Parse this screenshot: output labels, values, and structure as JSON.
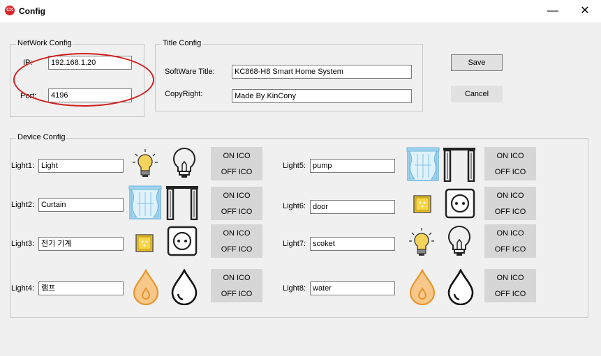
{
  "window": {
    "title": "Config",
    "app_icon_text": "CX",
    "minimize": "—",
    "maximize": "☐",
    "close": "✕"
  },
  "network": {
    "legend": "NetWork Config",
    "ip_label": "IP:",
    "ip_value": "192.168.1.20",
    "port_label": "Port:",
    "port_value": "4196"
  },
  "title_config": {
    "legend": "Title Config",
    "software_label": "SoftWare Title:",
    "software_value": "KC868-H8 Smart Home System",
    "copyright_label": "CopyRight:",
    "copyright_value": "Made By KinCony"
  },
  "actions": {
    "save": "Save",
    "cancel": "Cancel"
  },
  "device": {
    "legend": "Device Config",
    "on_ico": "ON ICO",
    "off_ico": "OFF ICO",
    "lights": [
      {
        "label": "Light1:",
        "value": "Light",
        "on_icon": "bulb-on-icon",
        "off_icon": "bulb-off-icon"
      },
      {
        "label": "Light2:",
        "value": "Curtain",
        "on_icon": "curtain-closed-icon",
        "off_icon": "curtain-open-icon"
      },
      {
        "label": "Light3:",
        "value": "전기 기계",
        "on_icon": "socket-on-icon",
        "off_icon": "socket-off-icon"
      },
      {
        "label": "Light4:",
        "value": "램프",
        "on_icon": "drop-on-icon",
        "off_icon": "drop-off-icon"
      },
      {
        "label": "Light5:",
        "value": "pump",
        "on_icon": "curtain-closed-icon",
        "off_icon": "curtain-open-icon"
      },
      {
        "label": "Light6:",
        "value": "door",
        "on_icon": "socket-on-icon",
        "off_icon": "socket-off-icon"
      },
      {
        "label": "Light7:",
        "value": "scoket",
        "on_icon": "bulb-on-icon",
        "off_icon": "bulb-off-icon"
      },
      {
        "label": "Light8:",
        "value": "water",
        "on_icon": "drop-on-icon",
        "off_icon": "drop-off-icon"
      }
    ]
  },
  "colors": {
    "annotation": "#d21f1f",
    "bulb_glow": "#f5d35c",
    "drop_fill": "#f7c88a",
    "drop_stroke": "#e8952e",
    "curtain": "#9fd3ee",
    "socket_on": "#f0c419"
  }
}
